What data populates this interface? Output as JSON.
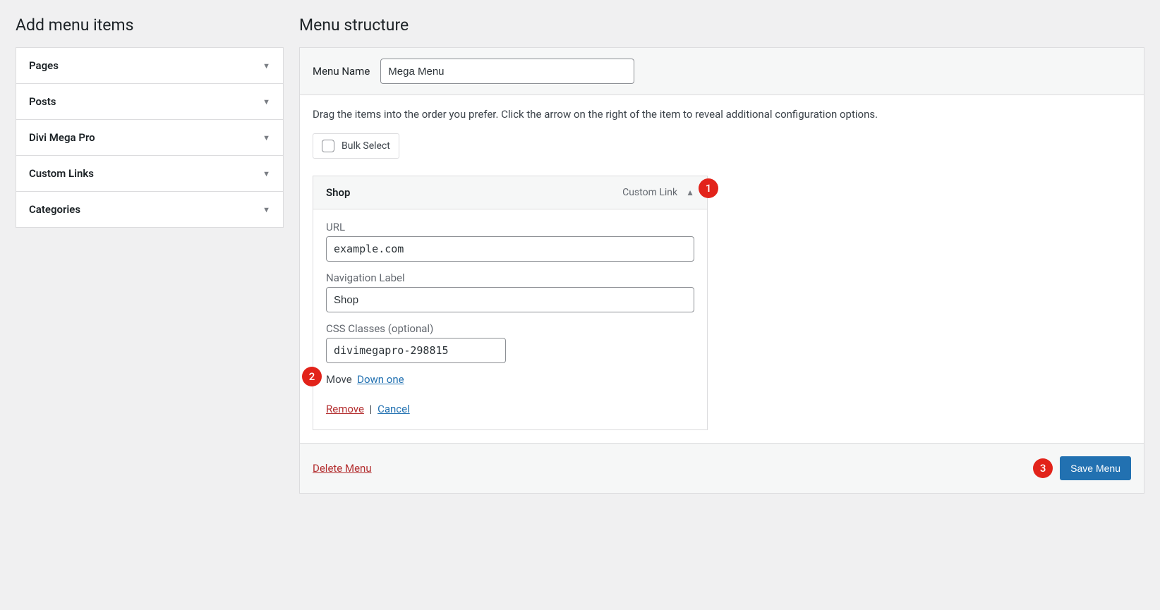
{
  "left": {
    "heading": "Add menu items",
    "items": [
      {
        "label": "Pages",
        "bold": true
      },
      {
        "label": "Posts",
        "bold": true
      },
      {
        "label": "Divi Mega Pro",
        "bold": true
      },
      {
        "label": "Custom Links",
        "bold": true
      },
      {
        "label": "Categories",
        "bold": true
      }
    ]
  },
  "right": {
    "heading": "Menu structure",
    "menu_name_label": "Menu Name",
    "menu_name_value": "Mega Menu",
    "instructions": "Drag the items into the order you prefer. Click the arrow on the right of the item to reveal additional configuration options.",
    "bulk_select": "Bulk Select",
    "item": {
      "title": "Shop",
      "type_label": "Custom Link",
      "url_label": "URL",
      "url_value": "example.com",
      "nav_label": "Navigation Label",
      "nav_value": "Shop",
      "css_label": "CSS Classes (optional)",
      "css_value": "divimegapro-298815",
      "move_label": "Move",
      "move_down": "Down one",
      "remove": "Remove",
      "cancel": "Cancel"
    },
    "delete_menu": "Delete Menu",
    "save_menu": "Save Menu"
  },
  "annotations": {
    "one": "1",
    "two": "2",
    "three": "3"
  }
}
